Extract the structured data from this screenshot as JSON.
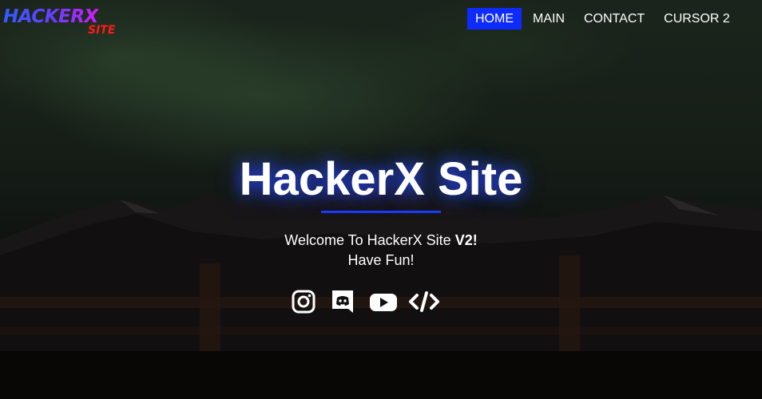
{
  "logo": {
    "main": "HACKERX",
    "sub": "SITE"
  },
  "nav": {
    "items": [
      {
        "label": "HOME",
        "active": true
      },
      {
        "label": "MAIN",
        "active": false
      },
      {
        "label": "CONTACT",
        "active": false
      },
      {
        "label": "CURSOR 2",
        "active": false
      }
    ]
  },
  "hero": {
    "title": "HackerX Site",
    "welcome_prefix": "Welcome To HackerX Site ",
    "welcome_version": "V2!",
    "subtitle": "Have Fun!"
  },
  "socials": [
    {
      "icon": "instagram-icon"
    },
    {
      "icon": "discord-icon"
    },
    {
      "icon": "youtube-icon"
    },
    {
      "icon": "code-icon"
    }
  ],
  "colors": {
    "accent": "#0d2bff",
    "logo_red": "#ff1a1a"
  }
}
